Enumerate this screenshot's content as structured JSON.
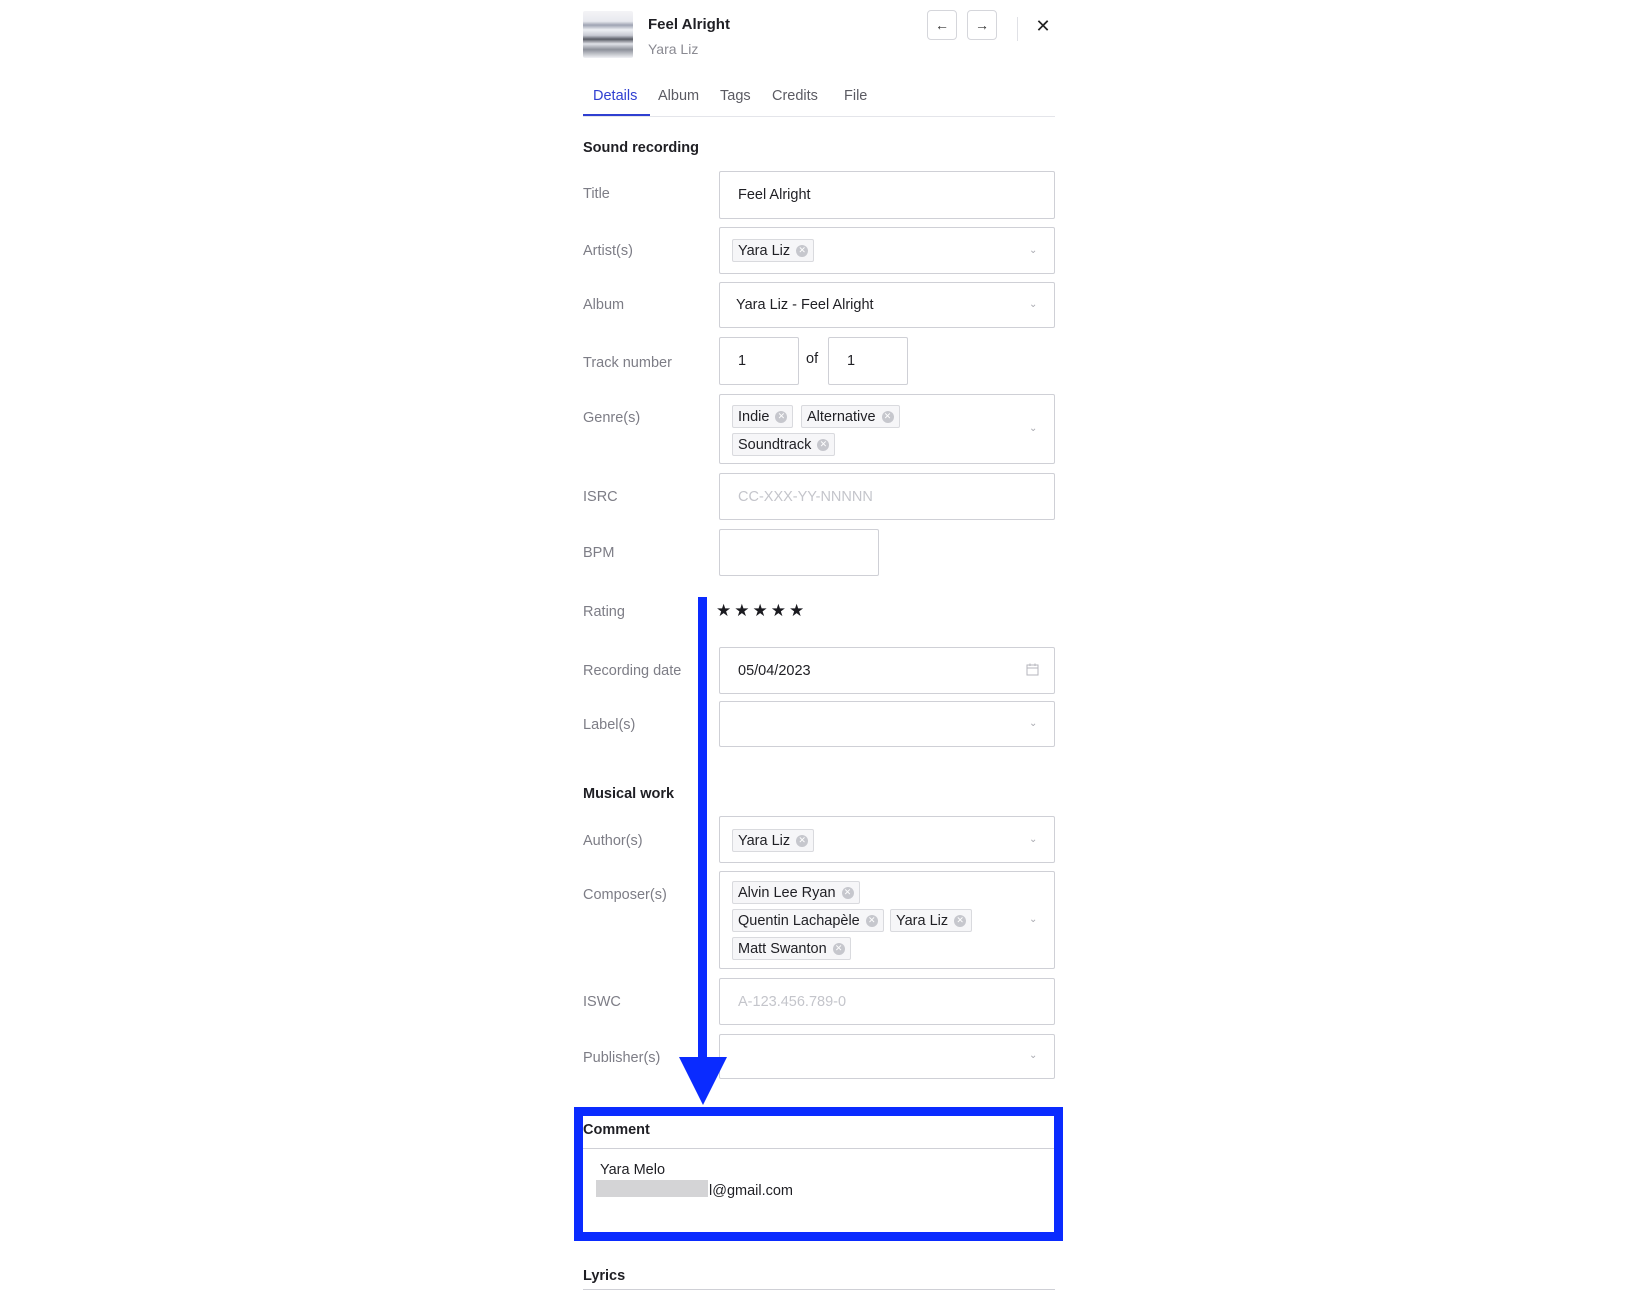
{
  "header": {
    "track_title": "Feel Alright",
    "track_artist": "Yara Liz",
    "prev_icon": "arrow-left-icon",
    "next_icon": "arrow-right-icon",
    "close_icon": "close-icon",
    "prev_glyph": "←",
    "next_glyph": "→",
    "close_glyph": "✕"
  },
  "tabs": [
    {
      "label": "Details",
      "active": true
    },
    {
      "label": "Album"
    },
    {
      "label": "Tags"
    },
    {
      "label": "Credits"
    },
    {
      "label": "File"
    }
  ],
  "sound_recording": {
    "section_title": "Sound recording",
    "title": {
      "label": "Title",
      "value": "Feel Alright"
    },
    "artists": {
      "label": "Artist(s)",
      "chips": [
        "Yara Liz"
      ]
    },
    "album": {
      "label": "Album",
      "value": "Yara Liz - Feel Alright"
    },
    "track_number": {
      "label": "Track number",
      "value": "1",
      "of_label": "of",
      "total": "1"
    },
    "genres": {
      "label": "Genre(s)",
      "chips": [
        "Indie",
        "Alternative",
        "Soundtrack"
      ]
    },
    "isrc": {
      "label": "ISRC",
      "placeholder": "CC-XXX-YY-NNNNN"
    },
    "bpm": {
      "label": "BPM",
      "value": ""
    },
    "rating": {
      "label": "Rating",
      "stars": "★★★★★",
      "value": 5,
      "max": 5
    },
    "recording_date": {
      "label": "Recording date",
      "value": "05/04/2023"
    },
    "labels": {
      "label": "Label(s)",
      "chips": []
    }
  },
  "musical_work": {
    "section_title": "Musical work",
    "authors": {
      "label": "Author(s)",
      "chips": [
        "Yara Liz"
      ]
    },
    "composers": {
      "label": "Composer(s)",
      "chips": [
        "Alvin Lee Ryan",
        "Quentin Lachapèle",
        "Yara Liz",
        "Matt Swanton"
      ]
    },
    "iswc": {
      "label": "ISWC",
      "placeholder": "A-123.456.789-0"
    },
    "publishers": {
      "label": "Publisher(s)",
      "chips": []
    }
  },
  "comment": {
    "section_title": "Comment",
    "line1": "Yara Melo",
    "line2_visible": "l@gmail.com"
  },
  "lyrics": {
    "section_title": "Lyrics"
  },
  "annotation": {
    "color": "#0a2bff"
  },
  "colors": {
    "accent": "#2f3fd1"
  }
}
